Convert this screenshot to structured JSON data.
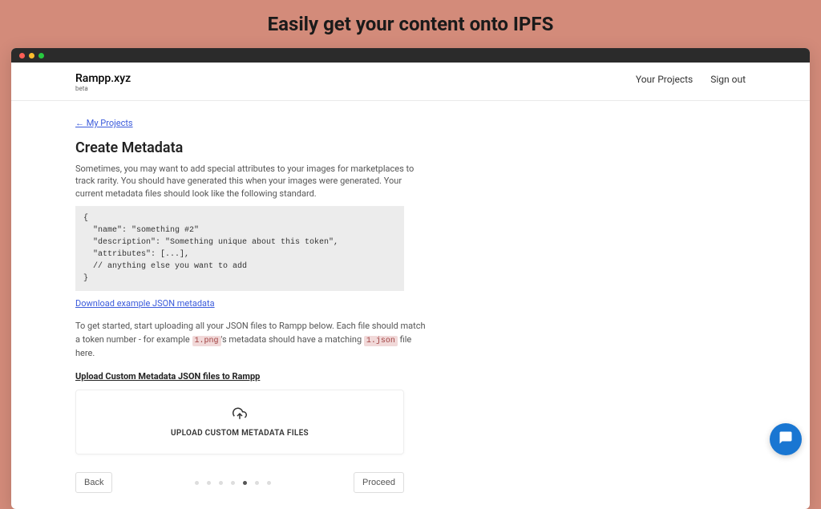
{
  "heading": "Easily get your content onto IPFS",
  "brand": {
    "name": "Rampp.xyz",
    "sub": "beta"
  },
  "nav": {
    "projects": "Your Projects",
    "signout": "Sign out"
  },
  "content": {
    "back_link": "← My Projects",
    "title": "Create Metadata",
    "description": "Sometimes, you may want to add special attributes to your images for marketplaces to track rarity. You should have generated this when your images were generated. Your current metadata files should look like the following standard.",
    "code_example": "{\n  \"name\": \"something #2\"\n  \"description\": \"Something unique about this token\",\n  \"attributes\": [...],\n  // anything else you want to add\n}",
    "download_link": "Download example JSON metadata",
    "instructions_pre": "To get started, start uploading all your JSON files to Rampp below. Each file should match a token number - for example ",
    "inline_code_1": "1.png",
    "instructions_mid": "'s metadata should have a matching ",
    "inline_code_2": "1.json",
    "instructions_post": " file here.",
    "upload_heading": "Upload Custom Metadata JSON files to Rampp",
    "upload_label": "UPLOAD CUSTOM METADATA FILES"
  },
  "footer": {
    "back": "Back",
    "proceed": "Proceed",
    "total_steps": 7,
    "active_step": 5
  }
}
